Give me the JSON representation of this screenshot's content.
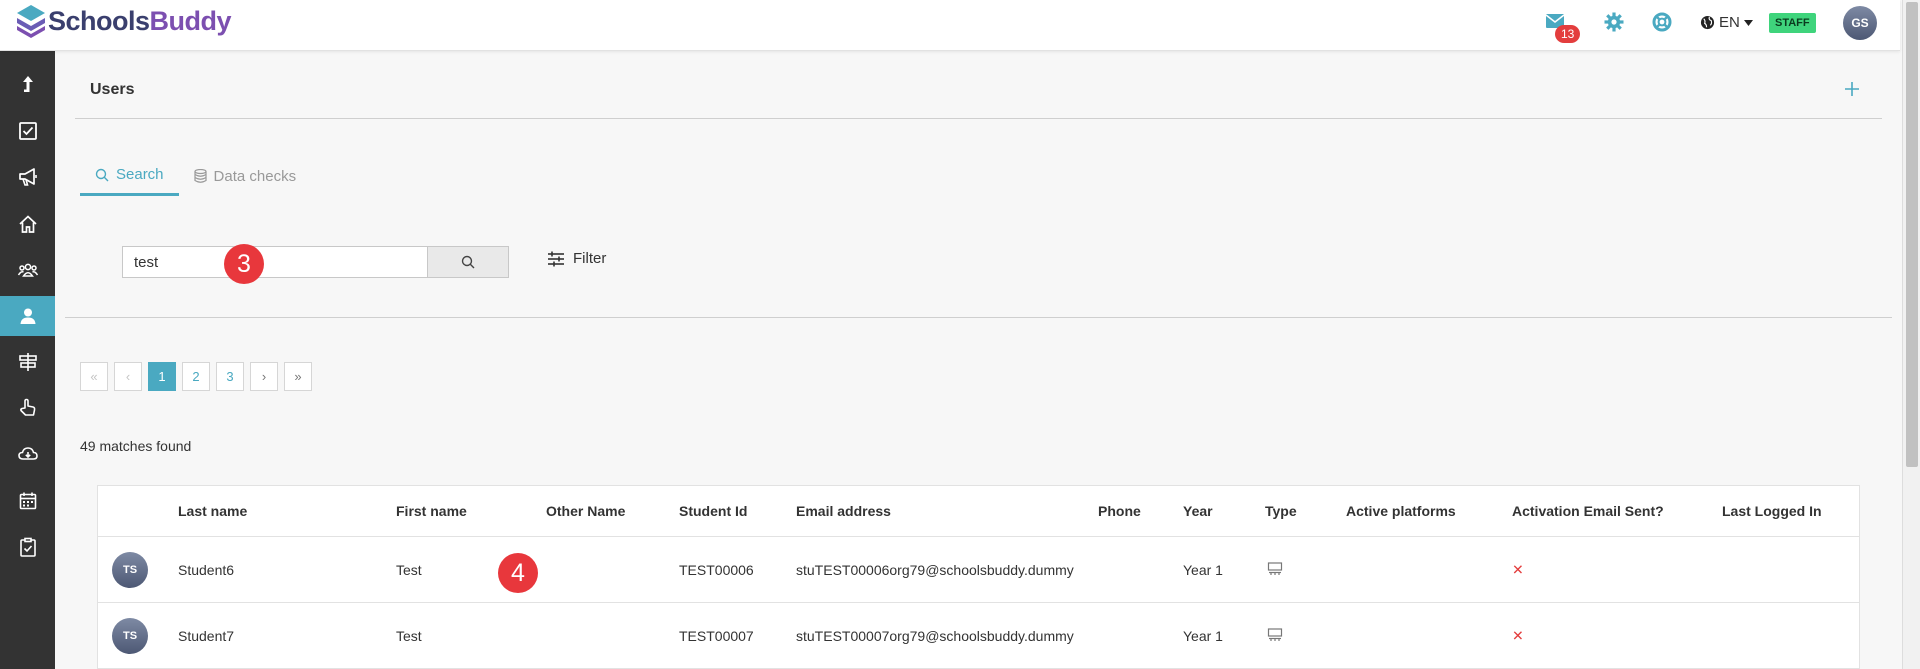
{
  "app": {
    "logo_part1": "Schools",
    "logo_part2": "Buddy"
  },
  "header": {
    "mail_count": "13",
    "language": "EN",
    "role_badge": "STAFF",
    "user_initials": "GS"
  },
  "page": {
    "title": "Users",
    "tabs": [
      {
        "label": "Search",
        "icon": "search-icon",
        "active": true
      },
      {
        "label": "Data checks",
        "icon": "database-icon",
        "active": false
      }
    ]
  },
  "search": {
    "value": "test",
    "filter_label": "Filter"
  },
  "markers": [
    "3",
    "4"
  ],
  "pagination": {
    "first": "«",
    "prev": "‹",
    "pages": [
      "1",
      "2",
      "3"
    ],
    "current": "1",
    "next": "›",
    "last": "»"
  },
  "results": {
    "count_text": "49 matches found"
  },
  "table": {
    "columns": [
      "Last name",
      "First name",
      "Other Name",
      "Student Id",
      "Email address",
      "Phone",
      "Year",
      "Type",
      "Active platforms",
      "Activation Email Sent?",
      "Last Logged In"
    ],
    "rows": [
      {
        "initials": "TS",
        "last_name": "Student6",
        "first_name": "Test",
        "other_name": "",
        "student_id": "TEST00006",
        "email": "stuTEST00006org79@schoolsbuddy.dummy",
        "phone": "",
        "year": "Year 1",
        "type_icon": "student-type-icon",
        "active_platforms": "",
        "activation_sent": "✕",
        "last_logged_in": ""
      },
      {
        "initials": "TS",
        "last_name": "Student7",
        "first_name": "Test",
        "other_name": "",
        "student_id": "TEST00007",
        "email": "stuTEST00007org79@schoolsbuddy.dummy",
        "phone": "",
        "year": "Year 1",
        "type_icon": "student-type-icon",
        "active_platforms": "",
        "activation_sent": "✕",
        "last_logged_in": ""
      }
    ]
  },
  "sidebar": {
    "items": [
      {
        "icon": "upload-arrow-icon",
        "active": false
      },
      {
        "icon": "checkbox-icon",
        "active": false
      },
      {
        "icon": "megaphone-icon",
        "active": false
      },
      {
        "icon": "home-icon",
        "active": false
      },
      {
        "icon": "groups-icon",
        "active": false
      },
      {
        "icon": "user-icon",
        "active": true
      },
      {
        "icon": "signpost-icon",
        "active": false
      },
      {
        "icon": "hand-pointer-icon",
        "active": false
      },
      {
        "icon": "cloud-download-icon",
        "active": false
      },
      {
        "icon": "calendar-icon",
        "active": false
      },
      {
        "icon": "clipboard-check-icon",
        "active": false
      }
    ]
  },
  "colors": {
    "accent": "#4aa9c1",
    "sidebar_bg": "#333333",
    "badge_red": "#e33d3d",
    "staff_green": "#3fd47c",
    "marker_red": "#e8373c"
  }
}
